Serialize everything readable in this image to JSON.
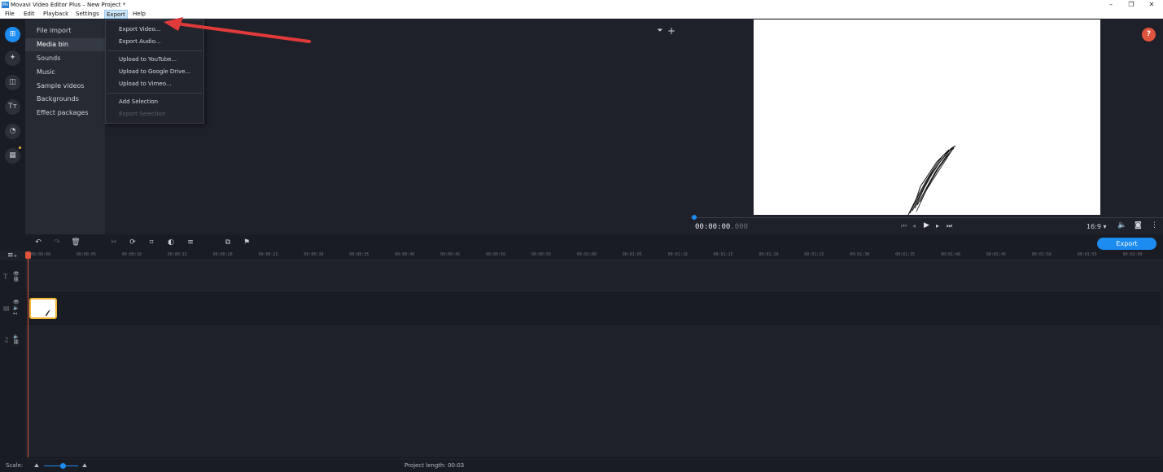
{
  "window": {
    "title": "Movavi Video Editor Plus – New Project *",
    "icon": "movavi-icon",
    "controls": [
      "–",
      "❐",
      "✕"
    ]
  },
  "menubar": {
    "items": [
      "File",
      "Edit",
      "Playback",
      "Settings",
      "Export",
      "Help"
    ],
    "active": "Export"
  },
  "export_menu": {
    "items": [
      {
        "label": "Export Video...",
        "enabled": true
      },
      {
        "label": "Export Audio...",
        "enabled": true
      },
      {
        "label": "Upload to YouTube...",
        "enabled": true
      },
      {
        "label": "Upload to Google Drive...",
        "enabled": true
      },
      {
        "label": "Upload to Vimeo...",
        "enabled": true
      },
      {
        "label": "Add Selection",
        "enabled": true
      },
      {
        "label": "Export Selection",
        "enabled": false
      }
    ]
  },
  "left_tools": [
    "import-icon",
    "magic-wand-icon",
    "transitions-icon",
    "titles-icon",
    "stickers-icon",
    "more-tools-icon"
  ],
  "categories": {
    "items": [
      "File import",
      "Media bin",
      "Sounds",
      "Music",
      "Sample videos",
      "Backgrounds",
      "Effect packages"
    ],
    "selected": "Media bin"
  },
  "media_bin": {
    "filter_icon": "filter-icon",
    "add_icon": "plus-icon"
  },
  "help_button": "?",
  "player": {
    "timecode_main": "00:00:00",
    "timecode_ms": ".000",
    "aspect": "16:9 ▾"
  },
  "timeline": {
    "export_label": "Export",
    "ruler": [
      "00:00:00",
      "00:00:05",
      "00:00:10",
      "00:00:15",
      "00:00:20",
      "00:00:25",
      "00:00:30",
      "00:00:35",
      "00:00:40",
      "00:00:45",
      "00:00:50",
      "00:00:55",
      "00:01:00",
      "00:01:05",
      "00:01:10",
      "00:01:15",
      "00:01:20",
      "00:01:25",
      "00:01:30",
      "00:01:35",
      "00:01:40",
      "00:01:45",
      "00:01:50",
      "00:01:55",
      "00:02:00"
    ]
  },
  "statusbar": {
    "scale_label": "Scale:",
    "scale_level": 0.55,
    "project_length": "Project length:  00:03"
  },
  "colors": {
    "accent": "#1c8cf0",
    "playhead": "#e0533c",
    "clip_border": "#f2b634",
    "annotation_arrow": "#e03a3a"
  }
}
